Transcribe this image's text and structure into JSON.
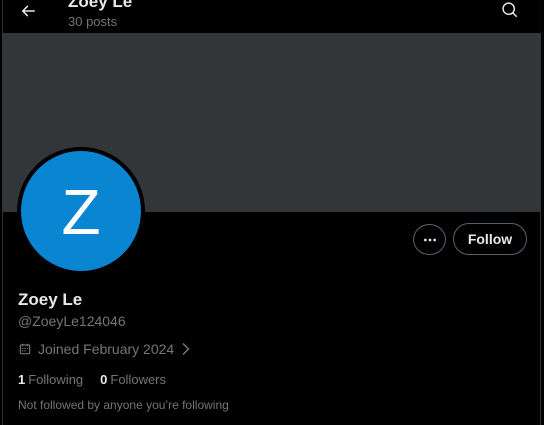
{
  "header": {
    "name": "Zoey Le",
    "posts": "30 posts",
    "back_icon": "arrow-left-icon",
    "search_icon": "search-icon"
  },
  "banner": {
    "color": "#333639"
  },
  "avatar": {
    "letter": "Z",
    "color": "#0a85d1"
  },
  "actions": {
    "more_icon": "more-horizontal-icon",
    "follow_label": "Follow"
  },
  "profile": {
    "display_name": "Zoey Le",
    "handle": "@ZoeyLe124046",
    "joined": "Joined February 2024",
    "following_count": "1",
    "following_label": "Following",
    "followers_count": "0",
    "followers_label": "Followers",
    "not_followed_text": "Not followed by anyone you’re following"
  },
  "colors": {
    "background": "#000000",
    "primary_text": "#e7e9ea",
    "secondary_text": "#71767b",
    "border": "#536471"
  }
}
